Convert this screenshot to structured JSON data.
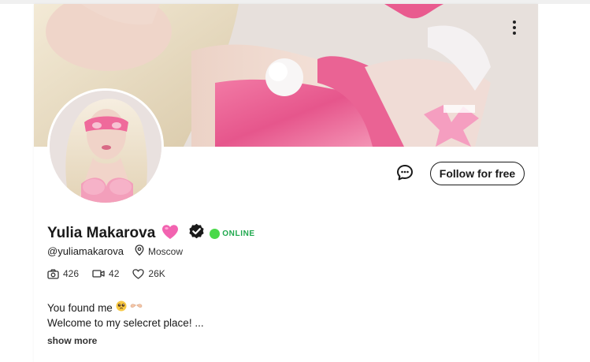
{
  "profile": {
    "name": "Yulia Makarova",
    "handle": "@yuliamakarova",
    "location": "Moscow",
    "status": "ONLINE",
    "status_color": "#1fa84d",
    "name_badge_icon": "pink-heart-icon",
    "verified_icon": "verified-check-icon"
  },
  "actions": {
    "follow_label": "Follow for free",
    "message_icon": "chat-bubble-icon",
    "more_icon": "kebab-menu-icon"
  },
  "stats": {
    "photos": "426",
    "videos": "42",
    "likes": "26K"
  },
  "bio": {
    "line1": "You found me",
    "line2": "Welcome to my selecret place! ...",
    "show_more": "show more"
  }
}
